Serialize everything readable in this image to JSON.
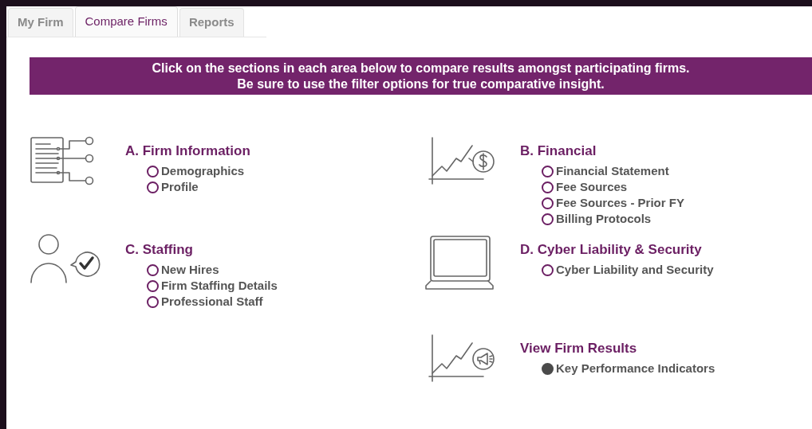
{
  "tabs": [
    {
      "label": "My Firm",
      "selected": false
    },
    {
      "label": "Compare Firms",
      "selected": true
    },
    {
      "label": "Reports",
      "selected": false
    }
  ],
  "banner": {
    "lines": [
      "Click on the sections in each area below to compare results amongst participating firms.",
      "Be sure to use the filter options for true comparative insight."
    ]
  },
  "columns": [
    [
      {
        "title": "A. Firm Information",
        "items": [
          {
            "label": "Demographics",
            "selected": false
          },
          {
            "label": "Profile",
            "selected": false
          }
        ]
      },
      {
        "title": "C. Staffing",
        "items": [
          {
            "label": "New Hires",
            "selected": false
          },
          {
            "label": "Firm Staffing Details",
            "selected": false
          },
          {
            "label": "Professional Staff",
            "selected": false
          }
        ]
      }
    ],
    [
      {
        "title": "B. Financial",
        "items": [
          {
            "label": "Financial Statement",
            "selected": false
          },
          {
            "label": "Fee Sources",
            "selected": false
          },
          {
            "label": "Fee Sources - Prior FY",
            "selected": false
          },
          {
            "label": "Billing Protocols",
            "selected": false
          }
        ]
      },
      {
        "title": "D. Cyber Liability & Security",
        "items": [
          {
            "label": "Cyber Liability and Security",
            "selected": false
          }
        ]
      },
      {
        "title": "View Firm Results",
        "items": [
          {
            "label": "Key Performance Indicators",
            "selected": true
          }
        ]
      }
    ]
  ]
}
